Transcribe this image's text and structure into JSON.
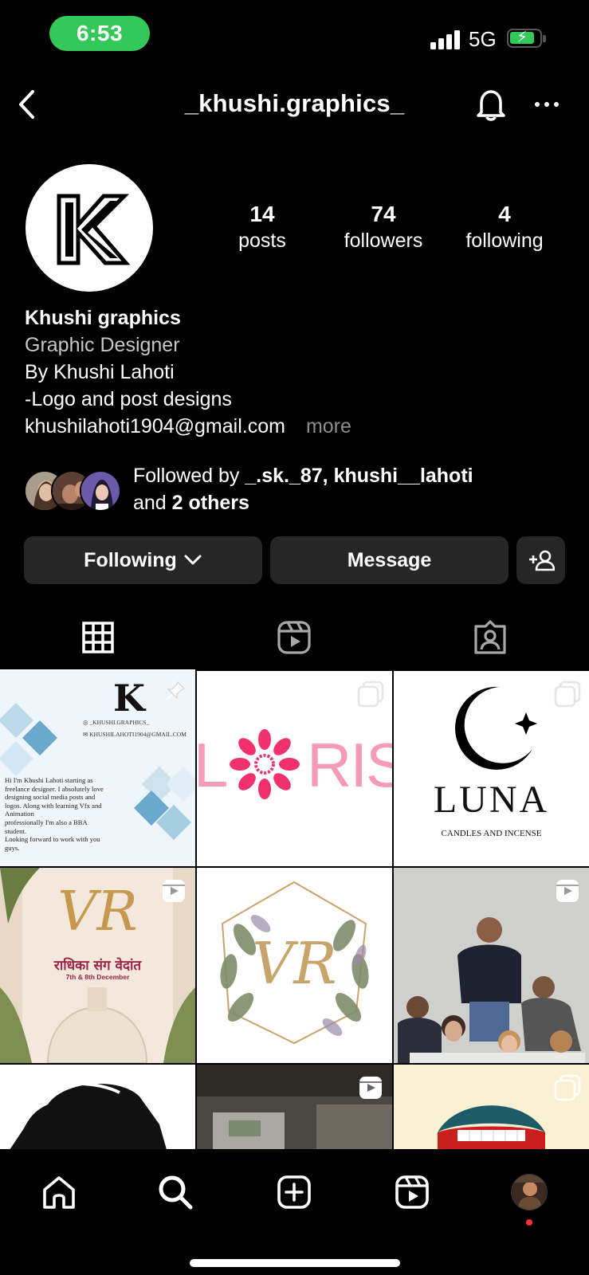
{
  "status_bar": {
    "time": "6:53",
    "network": "5G"
  },
  "header": {
    "username": "_khushi.graphics_"
  },
  "profile": {
    "avatar_letter": "K",
    "stats": [
      {
        "value": "14",
        "label": "posts"
      },
      {
        "value": "74",
        "label": "followers"
      },
      {
        "value": "4",
        "label": "following"
      }
    ],
    "name": "Khushi graphics",
    "category": "Graphic Designer",
    "bio_lines": [
      "By Khushi Lahoti",
      "-Logo and post designs",
      "khushilahoti1904@gmail.com"
    ],
    "more_label": "more",
    "followed_by": {
      "prefix": "Followed by",
      "users": "_.sk._87, khushi__lahoti",
      "and_label": "and",
      "others": "2 others"
    }
  },
  "actions": {
    "following_label": "Following",
    "message_label": "Message"
  },
  "posts": [
    {
      "type": "post",
      "pinned": true,
      "letter": "K",
      "handle": "_KHUSHI.GRAPHICS_",
      "email": "KHUSHILAHOTI1904@GMAIL.COM",
      "text_lines": [
        "Hi I'm Khushi Lahoti starting as",
        "freelance designer. I absolutely love",
        "designing social media posts and",
        "logos. Along with learning Vfx and",
        "Animation",
        "professionally I'm also a BBA",
        "student.",
        "Looking forward to work with you",
        "guys."
      ]
    },
    {
      "type": "carousel",
      "word_left": "L",
      "word_right": "RIS"
    },
    {
      "type": "carousel",
      "word": "LUNA",
      "subtitle": "CANDLES AND INCENSE"
    },
    {
      "type": "reel",
      "monogram": "VR",
      "hindi": "राधिका संग वेदांत",
      "date": "7th & 8th December"
    },
    {
      "type": "post",
      "monogram": "VR"
    },
    {
      "type": "reel"
    },
    {
      "type": "post"
    },
    {
      "type": "reel"
    },
    {
      "type": "carousel"
    }
  ],
  "colors": {
    "accent_green": "#34c759",
    "button_bg": "#262626",
    "notification_dot": "#ff3040",
    "floris_pink": "#f0316e"
  }
}
